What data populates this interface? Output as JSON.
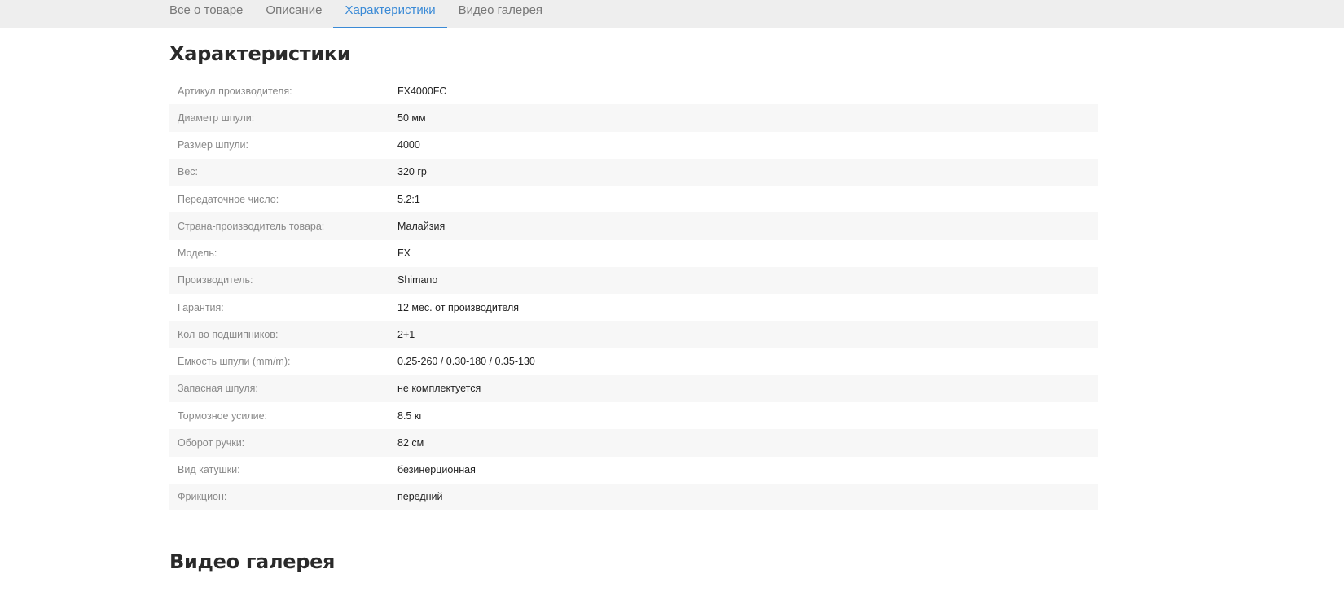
{
  "tabs": [
    {
      "label": "Все о товаре",
      "active": false
    },
    {
      "label": "Описание",
      "active": false
    },
    {
      "label": "Характеристики",
      "active": true
    },
    {
      "label": "Видео галерея",
      "active": false
    }
  ],
  "specs_title": "Характеристики",
  "specs": [
    {
      "key": "Артикул производителя:",
      "value": "FX4000FC"
    },
    {
      "key": "Диаметр шпули:",
      "value": "50 мм"
    },
    {
      "key": "Размер шпули:",
      "value": "4000"
    },
    {
      "key": "Вес:",
      "value": "320 гр"
    },
    {
      "key": "Передаточное число:",
      "value": "5.2:1"
    },
    {
      "key": "Страна-производитель товара:",
      "value": "Малайзия"
    },
    {
      "key": "Модель:",
      "value": "FX"
    },
    {
      "key": "Производитель:",
      "value": "Shimano"
    },
    {
      "key": "Гарантия:",
      "value": "12 мес. от производителя"
    },
    {
      "key": "Кол-во подшипников:",
      "value": "2+1"
    },
    {
      "key": "Емкость шпули (mm/m):",
      "value": "0.25-260 / 0.30-180 / 0.35-130"
    },
    {
      "key": "Запасная шпуля:",
      "value": "не комплектуется"
    },
    {
      "key": "Тормозное усилие:",
      "value": "8.5 кг"
    },
    {
      "key": "Оборот ручки:",
      "value": "82 см"
    },
    {
      "key": "Вид катушки:",
      "value": "безинерционная"
    },
    {
      "key": "Фрикцион:",
      "value": "передний"
    }
  ],
  "video_title": "Видео галерея"
}
